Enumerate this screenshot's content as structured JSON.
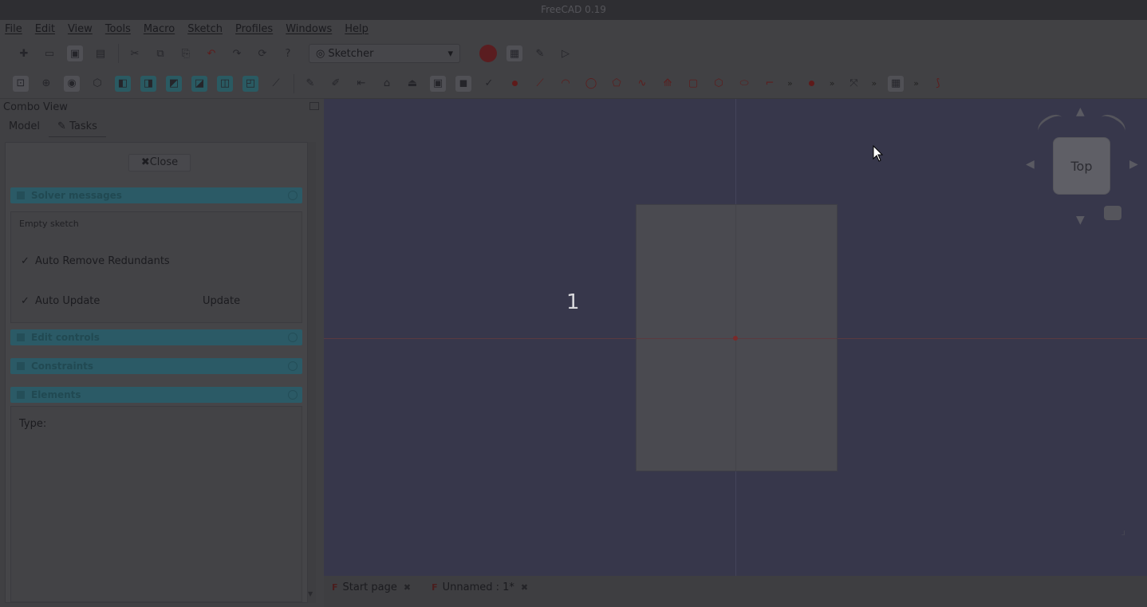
{
  "window": {
    "title": "FreeCAD 0.19"
  },
  "menu": [
    "File",
    "Edit",
    "View",
    "Tools",
    "Macro",
    "Sketch",
    "Profiles",
    "Windows",
    "Help"
  ],
  "toolbar": {
    "workbench": "Sketcher"
  },
  "combo": {
    "title": "Combo View",
    "tabs": [
      "Model",
      "Tasks"
    ],
    "close_label": "Close",
    "solver": {
      "header": "Solver messages",
      "message": "Empty sketch",
      "auto_remove": "Auto Remove Redundants",
      "auto_update": "Auto Update",
      "update": "Update"
    },
    "sections": [
      "Edit controls",
      "Constraints",
      "Elements"
    ],
    "elements": {
      "type_label": "Type:"
    }
  },
  "view": {
    "step_number": "1",
    "navcube_face": "Top"
  },
  "doc_tabs": [
    "Start page",
    "Unnamed : 1*"
  ],
  "colors": {
    "accent": "#2b5a66",
    "viewport": "#37374b",
    "origin": "#7a2a2a"
  }
}
